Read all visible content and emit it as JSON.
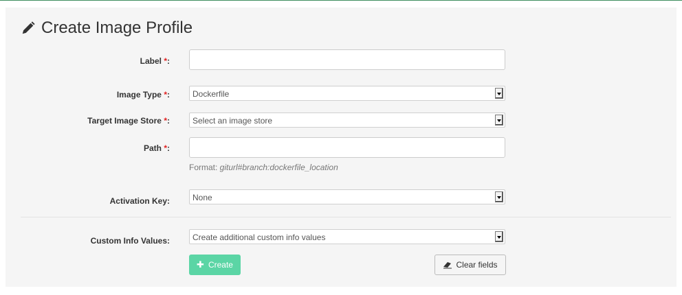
{
  "page": {
    "title": "Create Image Profile"
  },
  "form": {
    "label": {
      "label": "Label",
      "required_mark": "*",
      "colon": ":",
      "value": ""
    },
    "image_type": {
      "label": "Image Type",
      "required_mark": "*",
      "colon": ":",
      "selected": "Dockerfile"
    },
    "target_store": {
      "label": "Target Image Store",
      "required_mark": "*",
      "colon": ":",
      "selected": "Select an image store"
    },
    "path": {
      "label": "Path",
      "required_mark": "*",
      "colon": ":",
      "value": "",
      "help_prefix": "Format: ",
      "help_format": "giturl#branch:dockerfile_location"
    },
    "activation_key": {
      "label": "Activation Key:",
      "selected": "None"
    },
    "custom_info": {
      "label": "Custom Info Values:",
      "selected": "Create additional custom info values"
    }
  },
  "buttons": {
    "create": "Create",
    "clear": "Clear fields"
  },
  "colors": {
    "accent_line": "#3d8d5e",
    "create_button": "#5bd5a5",
    "required": "#e02020"
  },
  "icons": {
    "title": "pencil-icon",
    "create": "plus-icon",
    "clear": "eraser-icon"
  }
}
